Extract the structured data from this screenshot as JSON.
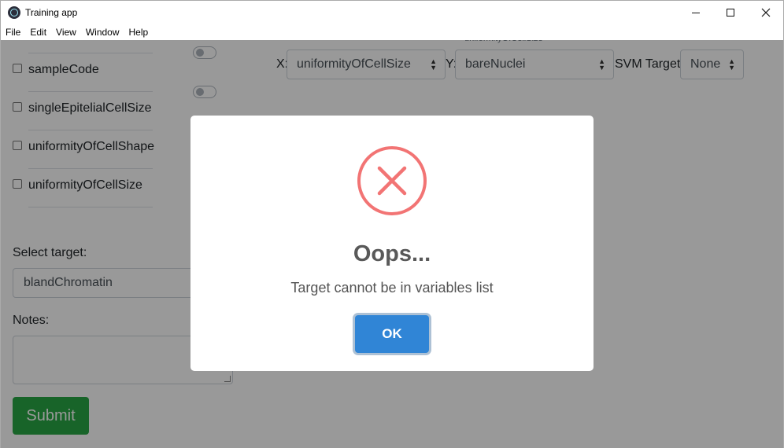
{
  "window": {
    "title": "Training app",
    "icon": "electron-app-icon"
  },
  "menu": {
    "items": [
      "File",
      "Edit",
      "View",
      "Window",
      "Help"
    ]
  },
  "variables": {
    "items": [
      {
        "label": "sampleCode",
        "checked": false
      },
      {
        "label": "singleEpitelialCellSize",
        "checked": false
      },
      {
        "label": "uniformityOfCellShape",
        "checked": false
      },
      {
        "label": "uniformityOfCellSize",
        "checked": false
      }
    ]
  },
  "plot_controls": {
    "x_label": "X:",
    "x_value": "uniformityOfCellSize",
    "y_label": "Y:",
    "y_value": "bareNuclei",
    "y_caption": "uniformityOfCellSize",
    "svm_label": "SVM Target:",
    "svm_value": "None"
  },
  "form": {
    "target_label": "Select target:",
    "target_value": "blandChromatin",
    "notes_label": "Notes:",
    "notes_value": "",
    "submit_label": "Submit",
    "submit_color": "#28a745"
  },
  "modal": {
    "icon": "error-x-icon",
    "icon_color": "#f27474",
    "title": "Oops...",
    "message": "Target cannot be in variables list",
    "ok_label": "OK",
    "ok_color": "#3085d6"
  }
}
